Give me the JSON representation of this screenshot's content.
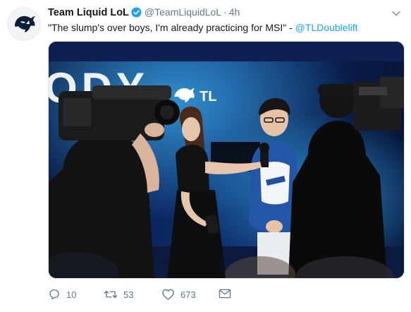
{
  "account": {
    "display_name": "Team Liquid LoL",
    "handle": "@TeamLiquidLoL",
    "separator": "·",
    "time": "4h"
  },
  "tweet": {
    "text": "\"The slump's over boys, I'm already practicing for MSI\" - ",
    "mention": "@TLDoublelift"
  },
  "media": {
    "backdrop_letters": "ODY",
    "logo_letters": "TL"
  },
  "actions": {
    "replies": "10",
    "retweets": "53",
    "likes": "673"
  },
  "colors": {
    "link": "#1da1f2",
    "muted": "#657786",
    "verified": "#1da1f2",
    "stage_blue": "#2d8fd8"
  },
  "icons": [
    "team-liquid-logo-icon",
    "verified-badge-icon",
    "chevron-down-icon",
    "reply-icon",
    "retweet-icon",
    "like-icon",
    "direct-message-icon"
  ]
}
